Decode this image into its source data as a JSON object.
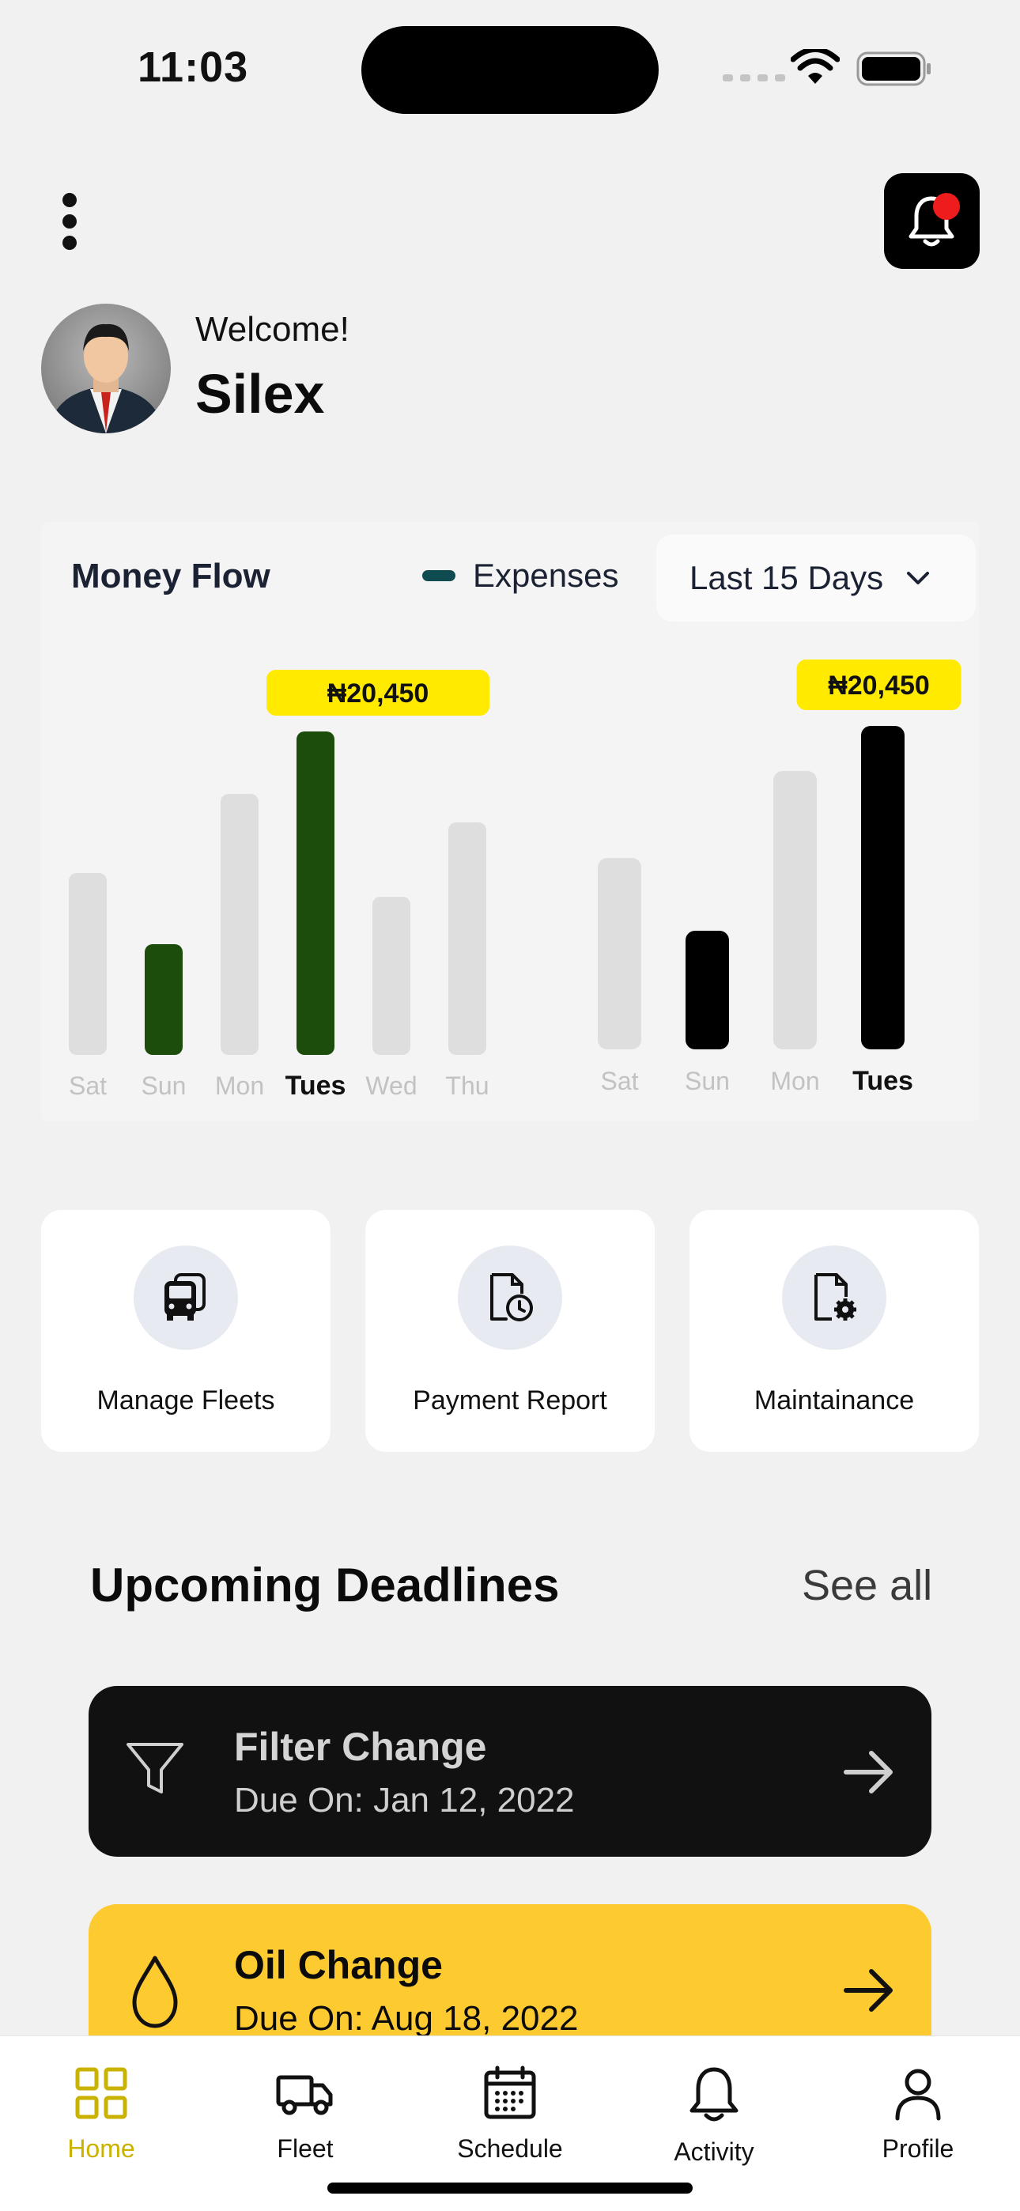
{
  "status_bar": {
    "time": "11:03"
  },
  "header": {
    "menu_icon": "more-vertical-icon",
    "notification_icon": "bell-icon",
    "has_unread": true
  },
  "user": {
    "greeting": "Welcome!",
    "name": "Silex",
    "avatar": "person-avatar"
  },
  "money_flow": {
    "title": "Money Flow",
    "legend_label": "Expenses",
    "range_label": "Last 15 Days",
    "colors": {
      "legend": "#0f4c52",
      "green": "#1d4d0c",
      "black": "#000000",
      "inactive": "#dedede",
      "tooltip": "#ffea00"
    }
  },
  "chart_data": [
    {
      "type": "bar",
      "categories": [
        "Sat",
        "Sun",
        "Mon",
        "Tues",
        "Wed",
        "Thu"
      ],
      "values": [
        11.5,
        7,
        16.5,
        20.45,
        10,
        14.7
      ],
      "highlighted": [
        "Sun",
        "Tues"
      ],
      "selected": "Tues",
      "tooltip": "₦20,450",
      "series_color": "#1d4d0c",
      "ylim": [
        0,
        21
      ]
    },
    {
      "type": "bar",
      "categories": [
        "Sat",
        "Sun",
        "Mon",
        "Tues"
      ],
      "values": [
        12.1,
        7.5,
        17.6,
        20.45
      ],
      "highlighted": [
        "Sun",
        "Tues"
      ],
      "selected": "Tues",
      "tooltip": "₦20,450",
      "series_color": "#000000",
      "ylim": [
        0,
        21
      ]
    }
  ],
  "quick_actions": [
    {
      "label": "Manage Fleets",
      "icon": "bus-icon"
    },
    {
      "label": "Payment Report",
      "icon": "document-clock-icon"
    },
    {
      "label": "Maintainance",
      "icon": "document-gear-icon"
    }
  ],
  "deadlines": {
    "title": "Upcoming Deadlines",
    "see_all": "See all",
    "items": [
      {
        "title": "Filter Change",
        "due": "Due On: Jan 12, 2022",
        "icon": "filter-icon"
      },
      {
        "title": "Oil Change",
        "due": "Due On: Aug 18, 2022",
        "icon": "droplet-icon"
      }
    ]
  },
  "bottom_nav": {
    "active": "Home",
    "items": [
      {
        "label": "Home",
        "icon": "grid-icon"
      },
      {
        "label": "Fleet",
        "icon": "truck-icon"
      },
      {
        "label": "Schedule",
        "icon": "calendar-icon"
      },
      {
        "label": "Activity",
        "icon": "bell-icon"
      },
      {
        "label": "Profile",
        "icon": "user-icon"
      }
    ]
  }
}
